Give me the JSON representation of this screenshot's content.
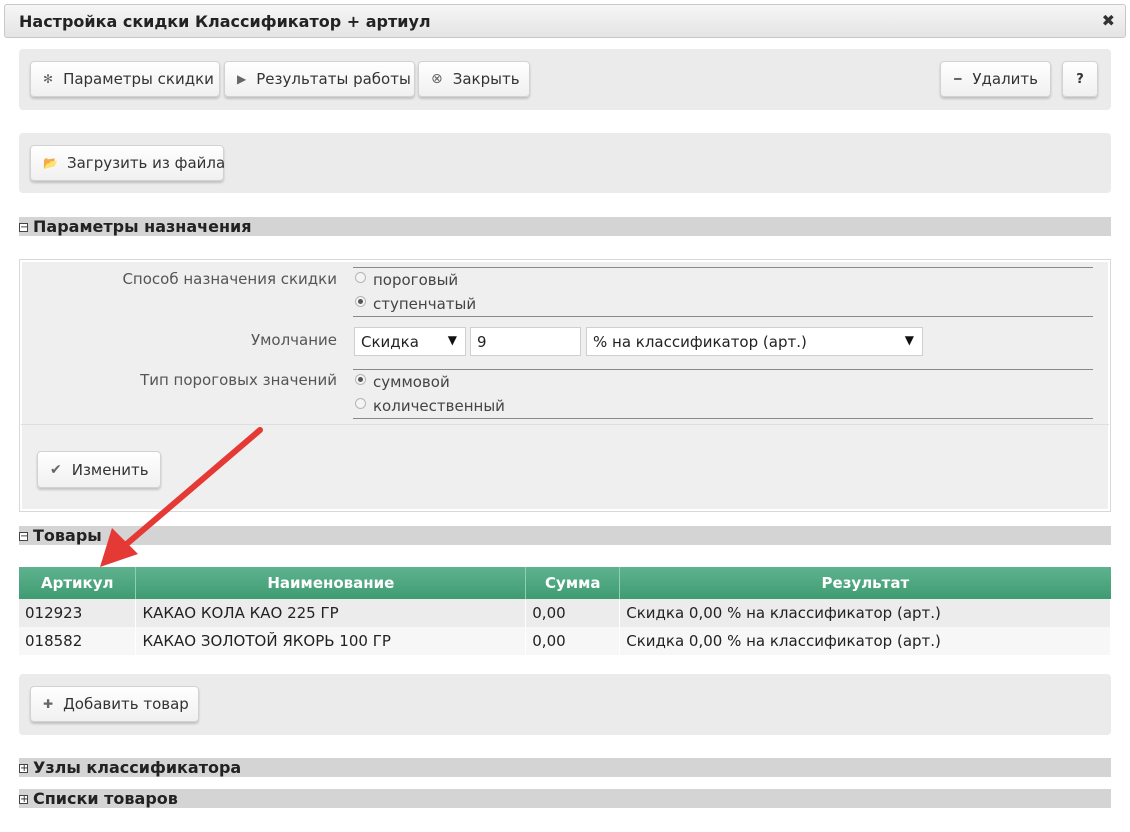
{
  "window": {
    "title": "Настройка скидки Классификатор + артиул",
    "close_glyph": "✖"
  },
  "toolbar": {
    "params_label": "Параметры скидки",
    "results_label": "Результаты работы",
    "close_label": "Закрыть",
    "delete_label": "Удалить",
    "help_label": "?"
  },
  "upload": {
    "label": "Загрузить из файла"
  },
  "sections": {
    "assign": {
      "title": "Параметры назначения",
      "toggle": "−"
    },
    "goods": {
      "title": "Товары",
      "toggle": "−"
    },
    "nodes": {
      "title": "Узлы классификатора",
      "toggle": "+"
    },
    "lists": {
      "title": "Списки товаров",
      "toggle": "+"
    }
  },
  "form": {
    "method_label": "Способ назначения скидки",
    "method_options": [
      "пороговый",
      "ступенчатый"
    ],
    "method_selected": "ступенчатый",
    "default_label": "Умолчание",
    "default_type": "Скидка",
    "default_value": "9",
    "default_unit": "% на классификатор (арт.)",
    "threshold_label": "Тип пороговых значений",
    "threshold_options": [
      "суммовой",
      "количественный"
    ],
    "threshold_selected": "суммовой",
    "change_label": "Изменить"
  },
  "table": {
    "headers": [
      "Артикул",
      "Наименование",
      "Сумма",
      "Результат"
    ],
    "rows": [
      [
        "012923",
        "КАКАО КОЛА КАО 225 ГР",
        "0,00",
        "Скидка 0,00 % на классификатор (арт.)"
      ],
      [
        "018582",
        "КАКАО ЗОЛОТОЙ ЯКОРЬ 100 ГР",
        "0,00",
        "Скидка 0,00 % на классификатор (арт.)"
      ]
    ]
  },
  "add_item": {
    "label": "Добавить товар"
  },
  "icons": {
    "gear": "gear-icon",
    "play": "play-icon",
    "close": "close-circle-icon",
    "minus": "minus-icon",
    "folder": "folder-open-icon",
    "check": "check-circle-icon",
    "plus": "plus-icon"
  },
  "colors": {
    "header_green": "#4aa57c",
    "annotation_arrow": "#e53935"
  }
}
